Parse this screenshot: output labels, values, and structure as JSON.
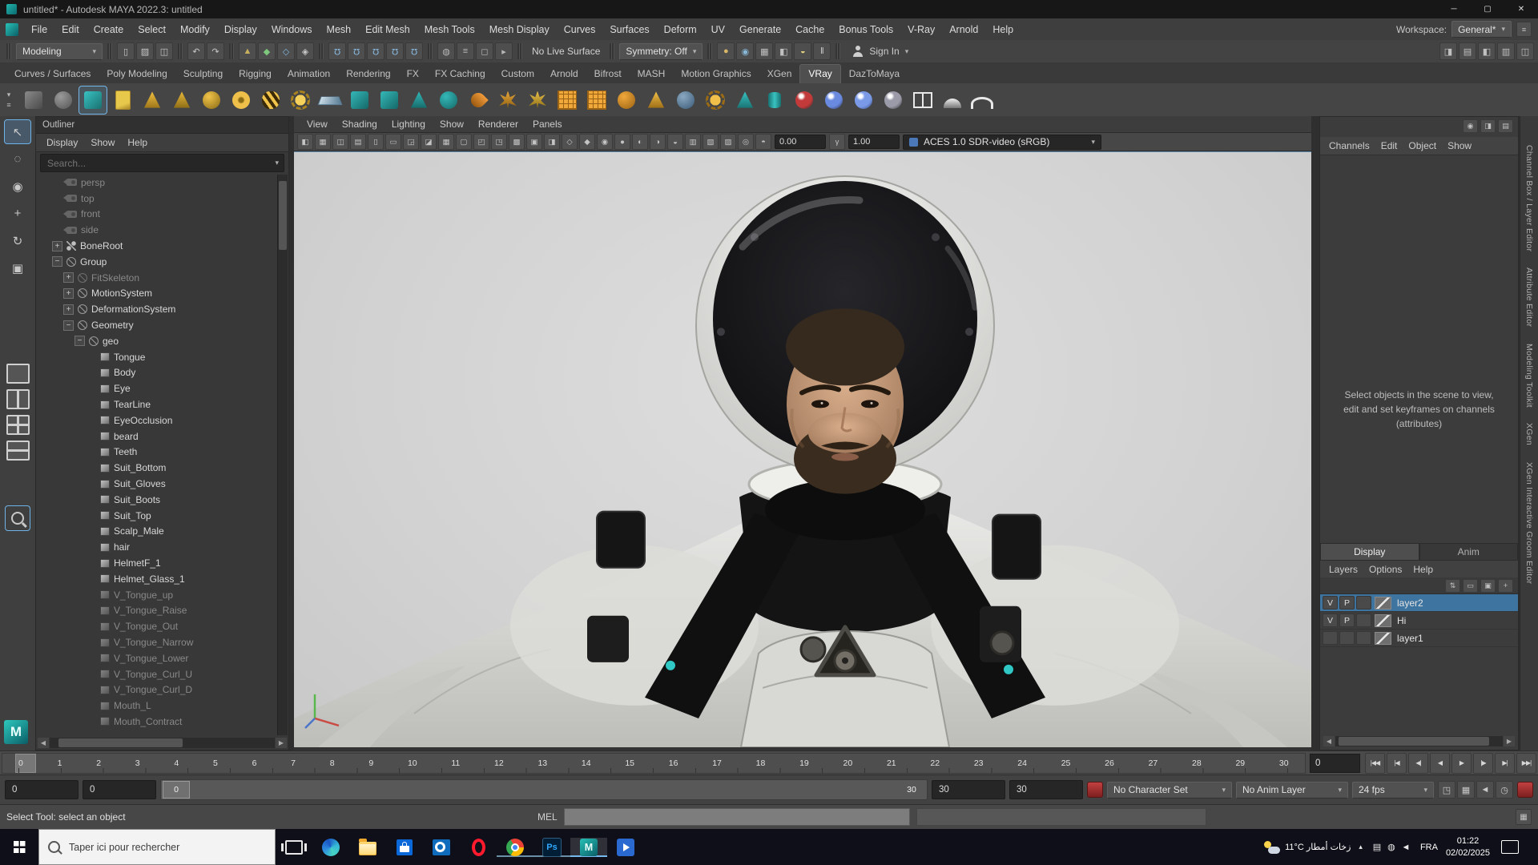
{
  "icons": {
    "caret": "▾",
    "min": "─",
    "max": "▢",
    "close": "✕",
    "left": "◀",
    "right": "▶"
  },
  "window": {
    "title": "untitled* - Autodesk MAYA 2022.3: untitled",
    "logo_letter": "M"
  },
  "menubar": {
    "items": [
      "File",
      "Edit",
      "Create",
      "Select",
      "Modify",
      "Display",
      "Windows",
      "Mesh",
      "Edit Mesh",
      "Mesh Tools",
      "Mesh Display",
      "Curves",
      "Surfaces",
      "Deform",
      "UV",
      "Generate",
      "Cache",
      "Bonus Tools",
      "V-Ray",
      "Arnold",
      "Help"
    ],
    "workspace_label": "Workspace:",
    "workspace_value": "General*"
  },
  "statusline": {
    "mode": "Modeling",
    "file_icons": [
      {
        "n": "new-scene-icon",
        "g": "▯",
        "c": "#c8c8c8"
      },
      {
        "n": "open-scene-icon",
        "g": "▨",
        "c": "#c8c8c8"
      },
      {
        "n": "save-scene-icon",
        "g": "◫",
        "c": "#c8c8c8"
      }
    ],
    "undo_icons": [
      {
        "n": "undo-icon",
        "g": "↶",
        "c": "#c8c8c8"
      },
      {
        "n": "redo-icon",
        "g": "↷",
        "c": "#c8c8c8"
      }
    ],
    "select_icons": [
      {
        "n": "select-hierarchy-icon",
        "g": "▲",
        "c": "#c8b060"
      },
      {
        "n": "select-object-icon",
        "g": "◆",
        "c": "#7ec87e"
      },
      {
        "n": "select-component-icon",
        "g": "◇",
        "c": "#80b8e0"
      },
      {
        "n": "select-mask-icon",
        "g": "◈",
        "c": "#c8c8c8"
      }
    ],
    "snap_icons": [
      {
        "n": "snap-to-grid-icon",
        "g": "Ω",
        "c": "#8cc0e8",
        "k": "rot"
      },
      {
        "n": "snap-to-curve-icon",
        "g": "Ω",
        "c": "#8cc0e8",
        "k": "rot"
      },
      {
        "n": "snap-to-point-icon",
        "g": "Ω",
        "c": "#8cc0e8",
        "k": "rot"
      },
      {
        "n": "snap-to-projected-center-icon",
        "g": "Ω",
        "c": "#8cc0e8",
        "k": "rot"
      },
      {
        "n": "snap-to-view-plane-icon",
        "g": "Ω",
        "c": "#8cc0e8",
        "k": "rot"
      }
    ],
    "hist_icons": [
      {
        "n": "make-live-icon",
        "g": "◍",
        "c": "#b8b8b8"
      },
      {
        "n": "construction-history-icon",
        "g": "≡",
        "c": "#b8b8b8"
      },
      {
        "n": "lock-selection-icon",
        "g": "◻",
        "c": "#b8b8b8"
      },
      {
        "n": "highlight-selection-icon",
        "g": "▸",
        "c": "#b8b8b8"
      }
    ],
    "live_label": "No Live Surface",
    "symmetry_label": "Symmetry: Off",
    "render_icons": [
      {
        "n": "render-current-frame-icon",
        "g": "●",
        "c": "#d8b868"
      },
      {
        "n": "ipr-render-icon",
        "g": "◉",
        "c": "#88b8d8"
      },
      {
        "n": "render-settings-icon",
        "g": "▦",
        "c": "#c0c0c0"
      },
      {
        "n": "display-settings-icon",
        "g": "◧",
        "c": "#c0c0c0"
      },
      {
        "n": "light-editor-icon",
        "g": "◒",
        "c": "#e0d080"
      },
      {
        "n": "pause-icon",
        "g": "‖",
        "c": "#d0d0d0"
      }
    ],
    "signin_label": "Sign In",
    "right_icons": [
      {
        "n": "toggle-modeling-toolkit-icon",
        "g": "◨",
        "c": "#c0c0c0"
      },
      {
        "n": "toggle-xgen-icon",
        "g": "▤",
        "c": "#c0c0c0"
      },
      {
        "n": "toggle-attribute-editor-icon",
        "g": "◧",
        "c": "#c0c0c0"
      },
      {
        "n": "toggle-tool-settings-icon",
        "g": "▥",
        "c": "#c0c0c0"
      },
      {
        "n": "toggle-channel-box-icon",
        "g": "◫",
        "c": "#c0c0c0"
      }
    ]
  },
  "shelf": {
    "gutter_icons": [
      {
        "n": "shelf-tab-menu-icon",
        "g": "▾"
      },
      {
        "n": "shelf-options-icon",
        "g": "≡"
      }
    ],
    "tabs": [
      {
        "label": "Curves / Surfaces"
      },
      {
        "label": "Poly Modeling"
      },
      {
        "label": "Sculpting"
      },
      {
        "label": "Rigging"
      },
      {
        "label": "Animation"
      },
      {
        "label": "Rendering"
      },
      {
        "label": "FX"
      },
      {
        "label": "FX Caching"
      },
      {
        "label": "Custom"
      },
      {
        "label": "Arnold"
      },
      {
        "label": "Bifrost"
      },
      {
        "label": "MASH"
      },
      {
        "label": "Motion Graphics"
      },
      {
        "label": "XGen"
      },
      {
        "label": "VRay",
        "active": true
      },
      {
        "label": "DazToMaya"
      }
    ],
    "buttons": [
      {
        "n": "poly-cube-shelf-icon",
        "shape": "sh-cube",
        "c1": "#8a8a8a",
        "c2": "#4a4a4a"
      },
      {
        "n": "poly-sphere-shelf-icon",
        "shape": "sh-sphere",
        "c1": "#9a9a9a",
        "c2": "#555555"
      },
      {
        "n": "vray-mesh-shelf-icon",
        "shape": "sh-cube",
        "c1": "#39c2c2",
        "c2": "#1a7070",
        "sel": true
      },
      {
        "n": "notes-shelf-icon",
        "shape": "sh-doc",
        "c1": "#e8c84a",
        "c2": "#a8862a"
      },
      {
        "n": "lamp-shelf-icon",
        "shape": "sh-cone",
        "c1": "#f0c040",
        "c2": "#9a7218"
      },
      {
        "n": "cone-shelf-icon",
        "shape": "sh-cone",
        "c1": "#e8b83a",
        "c2": "#8a6a14"
      },
      {
        "n": "gold-sphere-shelf-icon",
        "shape": "sh-sphere",
        "c1": "#f0c34a",
        "c2": "#8a6a14"
      },
      {
        "n": "torus-shelf-icon",
        "shape": "sh-torus",
        "c1": "#eec04a",
        "c2": "#8a6a14"
      },
      {
        "n": "bee-shelf-icon",
        "shape": "sh-bee",
        "c1": "#f0c34a",
        "c2": "#3a2a08"
      },
      {
        "n": "sun-shelf-icon",
        "shape": "sh-sun",
        "c1": "#f5d05a",
        "c2": "#a8821f"
      },
      {
        "n": "water-plane-shelf-icon",
        "shape": "sh-plane",
        "c1": "#cfe0ea",
        "c2": "#5a7d95"
      },
      {
        "n": "vray-proxy-export-shelf-icon",
        "shape": "sh-cube",
        "c1": "#35b8b8",
        "c2": "#156868"
      },
      {
        "n": "vray-proxy-import-shelf-icon",
        "shape": "sh-cube",
        "c1": "#35b8b8",
        "c2": "#156868"
      },
      {
        "n": "vray-scene-shelf-icon",
        "shape": "sh-cone",
        "c1": "#35b8b8",
        "c2": "#156868"
      },
      {
        "n": "vray-sphere-shelf-icon",
        "shape": "sh-sphere",
        "c1": "#35b8b8",
        "c2": "#156868"
      },
      {
        "n": "drop-shelf-icon",
        "shape": "sh-drop",
        "c1": "#f09a3a",
        "c2": "#9a5a10"
      },
      {
        "n": "plant-shelf-icon",
        "shape": "sh-plant",
        "c1": "#e8a83a",
        "c2": "#8a5a10"
      },
      {
        "n": "grass-shelf-icon",
        "shape": "sh-plant",
        "c1": "#e8c04a",
        "c2": "#8a6a14"
      },
      {
        "n": "fur-grid-shelf-icon",
        "shape": "sh-grid",
        "c1": "#f0a83a",
        "c2": "#9a6214"
      },
      {
        "n": "cloth-grid-shelf-icon",
        "shape": "sh-grid",
        "c1": "#f0a83a",
        "c2": "#9a6214"
      },
      {
        "n": "orange-sphere-shelf-icon",
        "shape": "sh-sphere",
        "c1": "#f0a83a",
        "c2": "#9a6214"
      },
      {
        "n": "goblet-shelf-icon",
        "shape": "sh-cone",
        "c1": "#f0c04a",
        "c2": "#9a6a14"
      },
      {
        "n": "half-sphere-shelf-icon",
        "shape": "sh-sphere",
        "c1": "#8aa8c0",
        "c2": "#3a5a78"
      },
      {
        "n": "gear-shelf-icon",
        "shape": "sh-sun",
        "c1": "#f0c04a",
        "c2": "#9a6a14"
      },
      {
        "n": "prism-shelf-icon",
        "shape": "sh-cone",
        "c1": "#3ac2c2",
        "c2": "#187070"
      },
      {
        "n": "cylinder-shelf-icon",
        "shape": "sh-cyl",
        "c1": "#3ac2c2",
        "c2": "#187070"
      },
      {
        "n": "vray-render-ball-shelf-icon",
        "shape": "sh-ball",
        "c1": "#c23a3a",
        "c2": "#2a2a2a"
      },
      {
        "n": "chrome-ball-shelf-icon",
        "shape": "sh-ball",
        "c1": "#6a8ae0",
        "c2": "#22284a"
      },
      {
        "n": "spheres-cluster-shelf-icon",
        "shape": "sh-ball",
        "c1": "#7a9ae8",
        "c2": "#2a3a6a"
      },
      {
        "n": "dark-ball-shelf-icon",
        "shape": "sh-ball",
        "c1": "#9a9aa8",
        "c2": "#2a2a30"
      },
      {
        "n": "pane-layout-shelf-icon",
        "shape": "sh-frame",
        "c1": "#e8e8e8",
        "c2": "#555555"
      },
      {
        "n": "dome-light-shelf-icon",
        "shape": "sh-dome",
        "c1": "#f0f0f0",
        "c2": "#777777"
      },
      {
        "n": "arc-shelf-icon",
        "shape": "sh-arc",
        "c1": "#e8e8e8",
        "c2": "#666666"
      }
    ]
  },
  "toolbox": {
    "tools": [
      {
        "n": "select-tool-icon",
        "g": "↖",
        "active": true
      },
      {
        "n": "lasso-tool-icon",
        "g": "◌"
      },
      {
        "n": "paint-select-tool-icon",
        "g": "◉"
      },
      {
        "n": "move-tool-icon",
        "g": "+"
      },
      {
        "n": "rotate-tool-icon",
        "g": "↻"
      },
      {
        "n": "scale-tool-icon",
        "g": "▣"
      }
    ]
  },
  "outliner": {
    "title": "Outliner",
    "menus": [
      "Display",
      "Show",
      "Help"
    ],
    "search_placeholder": "Search...",
    "tree": [
      {
        "label": "persp",
        "depth": 1,
        "icon": "ic-camera",
        "dim": true
      },
      {
        "label": "top",
        "depth": 1,
        "icon": "ic-camera",
        "dim": true
      },
      {
        "label": "front",
        "depth": 1,
        "icon": "ic-camera",
        "dim": true
      },
      {
        "label": "side",
        "depth": 1,
        "icon": "ic-camera",
        "dim": true
      },
      {
        "label": "BoneRoot",
        "depth": 1,
        "icon": "ic-joint",
        "exp": "+"
      },
      {
        "label": "Group",
        "depth": 1,
        "icon": "ic-transform",
        "exp": "−"
      },
      {
        "label": "FitSkeleton",
        "depth": 2,
        "icon": "ic-transform",
        "exp": "+",
        "dim": true
      },
      {
        "label": "MotionSystem",
        "depth": 2,
        "icon": "ic-transform",
        "exp": "+"
      },
      {
        "label": "DeformationSystem",
        "depth": 2,
        "icon": "ic-transform",
        "exp": "+"
      },
      {
        "label": "Geometry",
        "depth": 2,
        "icon": "ic-transform",
        "exp": "−"
      },
      {
        "label": "geo",
        "depth": 3,
        "icon": "ic-transform",
        "exp": "−"
      },
      {
        "label": "Tongue",
        "depth": 4,
        "icon": "ic-mesh"
      },
      {
        "label": "Body",
        "depth": 4,
        "icon": "ic-mesh"
      },
      {
        "label": "Eye",
        "depth": 4,
        "icon": "ic-mesh"
      },
      {
        "label": "TearLine",
        "depth": 4,
        "icon": "ic-mesh"
      },
      {
        "label": "EyeOcclusion",
        "depth": 4,
        "icon": "ic-mesh"
      },
      {
        "label": "beard",
        "depth": 4,
        "icon": "ic-mesh"
      },
      {
        "label": "Teeth",
        "depth": 4,
        "icon": "ic-mesh"
      },
      {
        "label": "Suit_Bottom",
        "depth": 4,
        "icon": "ic-mesh"
      },
      {
        "label": "Suit_Gloves",
        "depth": 4,
        "icon": "ic-mesh"
      },
      {
        "label": "Suit_Boots",
        "depth": 4,
        "icon": "ic-mesh"
      },
      {
        "label": "Suit_Top",
        "depth": 4,
        "icon": "ic-mesh"
      },
      {
        "label": "Scalp_Male",
        "depth": 4,
        "icon": "ic-mesh"
      },
      {
        "label": "hair",
        "depth": 4,
        "icon": "ic-mesh"
      },
      {
        "label": "HelmetF_1",
        "depth": 4,
        "icon": "ic-mesh"
      },
      {
        "label": "Helmet_Glass_1",
        "depth": 4,
        "icon": "ic-mesh"
      },
      {
        "label": "V_Tongue_up",
        "depth": 4,
        "icon": "ic-mesh",
        "dim": true
      },
      {
        "label": "V_Tongue_Raise",
        "depth": 4,
        "icon": "ic-mesh",
        "dim": true
      },
      {
        "label": "V_Tongue_Out",
        "depth": 4,
        "icon": "ic-mesh",
        "dim": true
      },
      {
        "label": "V_Tongue_Narrow",
        "depth": 4,
        "icon": "ic-mesh",
        "dim": true
      },
      {
        "label": "V_Tongue_Lower",
        "depth": 4,
        "icon": "ic-mesh",
        "dim": true
      },
      {
        "label": "V_Tongue_Curl_U",
        "depth": 4,
        "icon": "ic-mesh",
        "dim": true
      },
      {
        "label": "V_Tongue_Curl_D",
        "depth": 4,
        "icon": "ic-mesh",
        "dim": true
      },
      {
        "label": "Mouth_L",
        "depth": 4,
        "icon": "ic-mesh",
        "dim": true
      },
      {
        "label": "Mouth_Contract",
        "depth": 4,
        "icon": "ic-mesh",
        "dim": true
      }
    ]
  },
  "viewport": {
    "menus": [
      "View",
      "Shading",
      "Lighting",
      "Show",
      "Renderer",
      "Panels"
    ],
    "toolbar_icons": [
      {
        "n": "renderer-icon",
        "g": "◧"
      },
      {
        "n": "select-camera-icon",
        "g": "▦"
      },
      {
        "n": "lock-camera-icon",
        "g": "◫"
      },
      {
        "n": "camera-attributes-icon",
        "g": "▤"
      },
      {
        "n": "bookmarks-icon",
        "g": "▯"
      },
      {
        "n": "image-plane-icon",
        "g": "▭"
      },
      {
        "n": "pan-zoom-icon",
        "g": "◲"
      },
      {
        "n": "grease-pencil-icon",
        "g": "◪"
      },
      {
        "n": "grid-icon",
        "g": "▦"
      },
      {
        "n": "film-gate-icon",
        "g": "▢"
      },
      {
        "n": "resolution-gate-icon",
        "g": "◰"
      },
      {
        "n": "gate-mask-icon",
        "g": "◳"
      },
      {
        "n": "field-chart-icon",
        "g": "▩"
      },
      {
        "n": "safe-action-icon",
        "g": "▣"
      },
      {
        "n": "safe-title-icon",
        "g": "◨"
      },
      {
        "n": "frame-all-icon",
        "g": "◇"
      },
      {
        "n": "frame-selected-icon",
        "g": "◆"
      },
      {
        "n": "isolate-select-icon",
        "g": "◉"
      },
      {
        "n": "lighting-icon",
        "g": "●"
      },
      {
        "n": "shadows-icon",
        "g": "◐"
      },
      {
        "n": "ao-icon",
        "g": "◑"
      },
      {
        "n": "motion-blur-icon",
        "g": "◒"
      },
      {
        "n": "multisample-icon",
        "g": "▥"
      },
      {
        "n": "textures-icon",
        "g": "▧"
      },
      {
        "n": "wireframe-shaded-icon",
        "g": "▨"
      },
      {
        "n": "xray-icon",
        "g": "◎"
      }
    ],
    "exposure_icon": "◓",
    "exposure": "0.00",
    "gamma_icon": "γ",
    "gamma": "1.00",
    "colorspace": "ACES 1.0 SDR-video (sRGB)"
  },
  "channelbox": {
    "top_icons": [
      {
        "n": "pin-panel-icon",
        "g": "◉"
      },
      {
        "n": "channel-display-mode-icon",
        "g": "◨"
      },
      {
        "n": "channel-settings-icon",
        "g": "▤"
      }
    ],
    "menus": [
      "Channels",
      "Edit",
      "Object",
      "Show"
    ],
    "empty_text": "Select objects in the scene to view, edit and set keyframes on channels (attributes)"
  },
  "layers": {
    "tabs": [
      {
        "label": "Display",
        "active": true
      },
      {
        "label": "Anim"
      }
    ],
    "menus": [
      "Layers",
      "Options",
      "Help"
    ],
    "icons": [
      {
        "n": "layer-sort-icon",
        "g": "⇅"
      },
      {
        "n": "layer-options-icon",
        "g": "▭"
      },
      {
        "n": "new-empty-layer-icon",
        "g": "▣"
      },
      {
        "n": "new-layer-from-selected-icon",
        "g": "+"
      }
    ],
    "rows": [
      {
        "v": "V",
        "p": "P",
        "name": "layer2",
        "selected": true
      },
      {
        "v": "V",
        "p": "P",
        "name": "Hi"
      },
      {
        "v": "",
        "p": "",
        "name": "layer1"
      }
    ]
  },
  "edge_tabs": [
    "Channel Box / Layer Editor",
    "Attribute Editor",
    "Modeling Toolkit",
    "XGen",
    "XGen Interactive Groom Editor"
  ],
  "timeline": {
    "labels": [
      "0",
      "1",
      "2",
      "3",
      "4",
      "5",
      "6",
      "7",
      "8",
      "9",
      "10",
      "11",
      "12",
      "13",
      "14",
      "15",
      "16",
      "17",
      "18",
      "19",
      "20",
      "21",
      "22",
      "23",
      "24",
      "25",
      "26",
      "27",
      "28",
      "29",
      "30"
    ],
    "current": "0",
    "transport": [
      {
        "n": "go-to-start-button",
        "g": "|◀◀"
      },
      {
        "n": "step-back-frame-button",
        "g": "|◀"
      },
      {
        "n": "step-back-key-button",
        "g": "◀|"
      },
      {
        "n": "play-backwards-button",
        "g": "◀"
      },
      {
        "n": "play-forwards-button",
        "g": "▶"
      },
      {
        "n": "step-forward-key-button",
        "g": "|▶"
      },
      {
        "n": "step-forward-frame-button",
        "g": "▶|"
      },
      {
        "n": "go-to-end-button",
        "g": "▶▶|"
      }
    ]
  },
  "range": {
    "anim_start": "0",
    "play_start": "0",
    "handle_start": "0",
    "handle_end": "30",
    "play_end": "30",
    "anim_end": "30",
    "character_set": "No Character Set",
    "anim_layer": "No Anim Layer",
    "fps": "24 fps",
    "icons": [
      {
        "n": "playblast-icon",
        "g": "◳"
      },
      {
        "n": "ghost-icon",
        "g": "▦"
      },
      {
        "n": "sound-icon",
        "g": "◄"
      },
      {
        "n": "anim-preferences-icon",
        "g": "◷"
      }
    ]
  },
  "helpline": {
    "status": "Select Tool: select an object",
    "mel": "MEL"
  },
  "taskbar": {
    "search_placeholder": "Taper ici pour rechercher",
    "apps": [
      {
        "n": "task-view-button",
        "kind": "taskview"
      },
      {
        "n": "edge-icon",
        "kind": "edge"
      },
      {
        "n": "file-explorer-icon",
        "kind": "explorer"
      },
      {
        "n": "store-icon",
        "kind": "store"
      },
      {
        "n": "outlook-icon",
        "kind": "outlook"
      },
      {
        "n": "opera-icon",
        "kind": "opera"
      },
      {
        "n": "chrome-icon",
        "kind": "chrome",
        "open": true
      },
      {
        "n": "photoshop-icon",
        "kind": "ps",
        "label": "Ps",
        "open": true
      },
      {
        "n": "maya-icon",
        "kind": "maya",
        "label": "M",
        "active": true
      },
      {
        "n": "remote-app-icon",
        "kind": "remote"
      }
    ],
    "weather": "11°C زخات أمطار",
    "chevron": "▴",
    "tray_icons": [
      {
        "n": "touch-keyboard-icon",
        "g": "▤"
      },
      {
        "n": "network-icon",
        "g": "◍"
      },
      {
        "n": "volume-icon",
        "g": "◄"
      }
    ],
    "lang": "FRA",
    "time": "01:22",
    "date": "02/02/2025"
  }
}
